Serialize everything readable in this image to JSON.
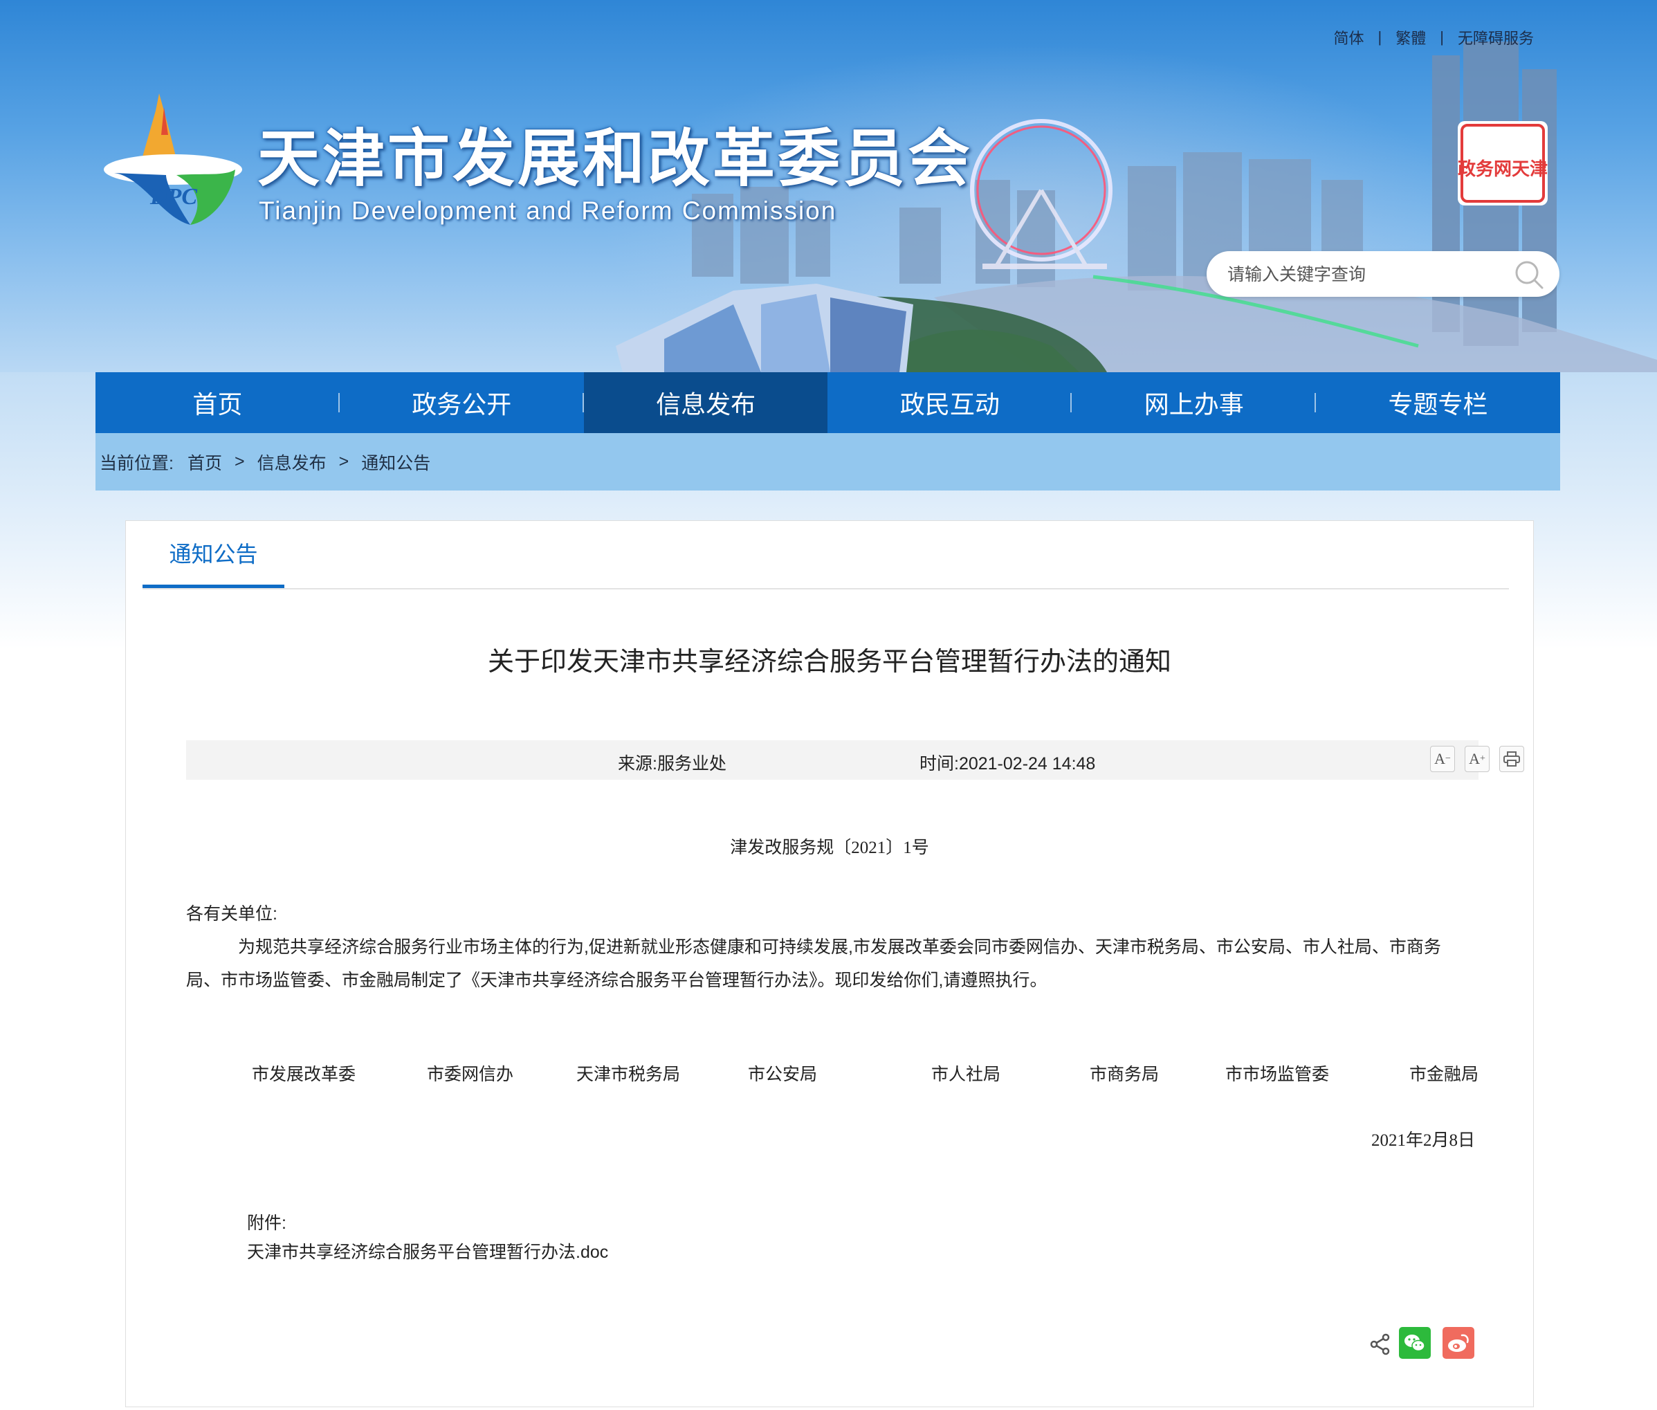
{
  "top_links": [
    "简体",
    "繁體",
    "无障碍服务"
  ],
  "site": {
    "title": "天津市发展和改革委员会",
    "subtitle": "Tianjin Development and Reform Commission",
    "logo_text": "DPC",
    "seal_text": "政务网天津"
  },
  "search": {
    "placeholder": "请输入关键字查询"
  },
  "nav": {
    "items": [
      "首页",
      "政务公开",
      "信息发布",
      "政民互动",
      "网上办事",
      "专题专栏"
    ],
    "active": "信息发布"
  },
  "breadcrumb": {
    "label": "当前位置:",
    "items": [
      "首页",
      "信息发布",
      "通知公告"
    ],
    "separator": ">"
  },
  "section_tab": "通知公告",
  "article": {
    "title": "关于印发天津市共享经济综合服务平台管理暂行办法的通知",
    "source": "来源:服务业处",
    "time": "时间:2021-02-24 14:48",
    "doc_number": "津发改服务规〔2021〕1号",
    "salutation": "各有关单位:",
    "body": "为规范共享经济综合服务行业市场主体的行为,促进新就业形态健康和可持续发展,市发展改革委会同市委网信办、天津市税务局、市公安局、市人社局、市商务局、市市场监管委、市金融局制定了《天津市共享经济综合服务平台管理暂行办法》。现印发给你们,请遵照执行。",
    "issuers": [
      "市发展改革委",
      "市委网信办",
      "天津市税务局",
      "市公安局",
      "市人社局",
      "市商务局",
      "市市场监管委",
      "市金融局"
    ],
    "date": "2021年2月8日",
    "attachment_label": "附件:",
    "attachment_file": "天津市共享经济综合服务平台管理暂行办法.doc"
  },
  "tools": {
    "font_smaller": "A",
    "font_larger": "A"
  },
  "colors": {
    "nav_bg": "#0e6cc6",
    "nav_active": "#0a4c8d",
    "breadcrumb_bg": "#93c7ee",
    "wechat": "#2dba3c",
    "weibo": "#f06b5e"
  },
  "icons": {
    "search": "search-icon",
    "print": "printer-icon",
    "share": "share-icon",
    "wechat": "wechat-icon",
    "weibo": "weibo-icon"
  }
}
